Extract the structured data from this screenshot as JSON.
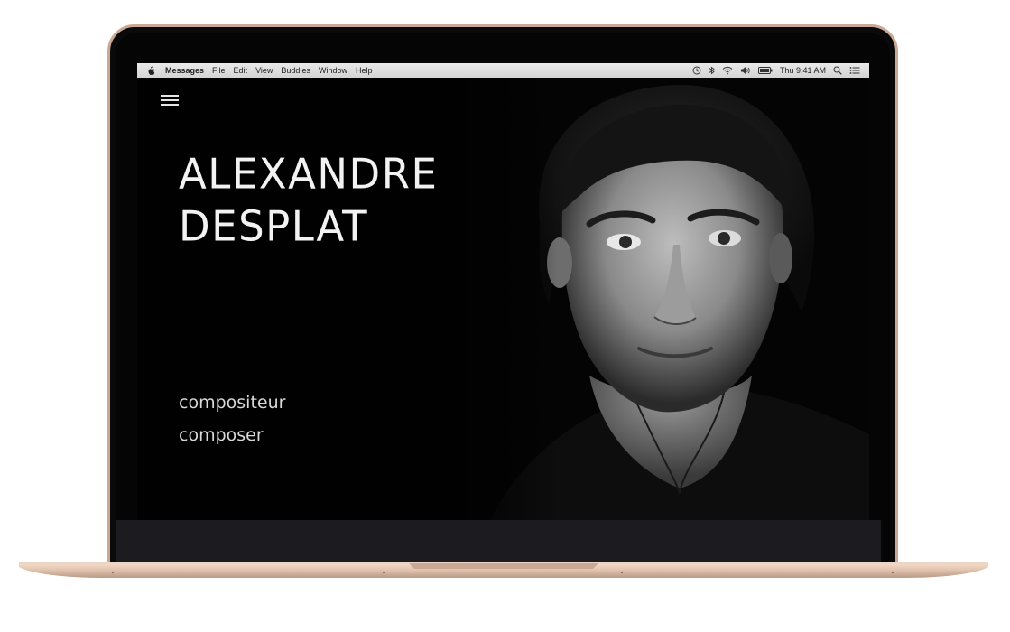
{
  "menubar": {
    "app_name": "Messages",
    "menus": [
      "File",
      "Edit",
      "View",
      "Buddies",
      "Window",
      "Help"
    ],
    "clock": "Thu 9:41 AM"
  },
  "hero": {
    "name_line1": "ALEXANDRE",
    "name_line2": "DESPLAT",
    "role_fr": "compositeur",
    "role_en": "composer"
  },
  "colors": {
    "background": "#020202",
    "title_text": "#f2f2f2",
    "menubar": "#dedede",
    "laptop_gold": "#e6c8b4"
  },
  "icons": [
    "apple-icon",
    "time-machine-icon",
    "bluetooth-icon",
    "wifi-icon",
    "volume-icon",
    "battery-icon",
    "search-icon",
    "notification-center-icon",
    "hamburger-menu-icon"
  ]
}
